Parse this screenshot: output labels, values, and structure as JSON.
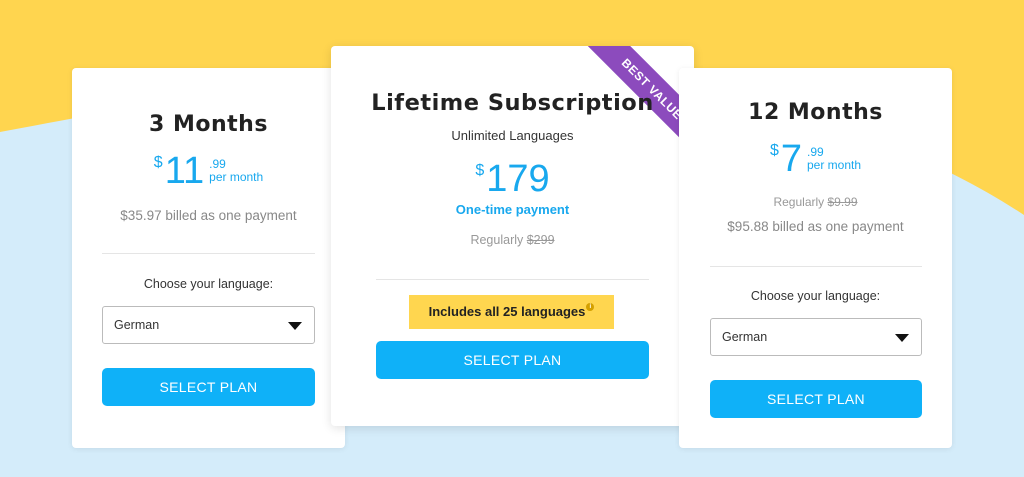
{
  "plans": {
    "three_months": {
      "title": "3 Months",
      "currency": "$",
      "price_whole": "11",
      "price_cents": ".99",
      "per": "per month",
      "billed": "$35.97 billed as one payment",
      "choose_label": "Choose your language:",
      "language": "German",
      "button": "SELECT PLAN"
    },
    "lifetime": {
      "title": "Lifetime Subscription",
      "subtitle": "Unlimited Languages",
      "currency": "$",
      "price_whole": "179",
      "payment_type": "One-time payment",
      "regular_label": "Regularly ",
      "regular_price": "$299",
      "includes": "Includes all 25 languages",
      "info_glyph": "i",
      "ribbon": "BEST VALUE",
      "button": "SELECT PLAN"
    },
    "twelve_months": {
      "title": "12 Months",
      "currency": "$",
      "price_whole": "7",
      "price_cents": ".99",
      "per": "per month",
      "regular_label": "Regularly ",
      "regular_price": "$9.99",
      "billed": "$95.88 billed as one payment",
      "choose_label": "Choose your language:",
      "language": "German",
      "button": "SELECT PLAN"
    }
  },
  "colors": {
    "accent_blue": "#0fb1f8",
    "price_blue": "#18a8ee",
    "ribbon_purple": "#8c4bbd",
    "highlight_yellow": "#ffd64f",
    "background_yellow": "#ffd54f",
    "background_blue": "#d4ecfa"
  }
}
